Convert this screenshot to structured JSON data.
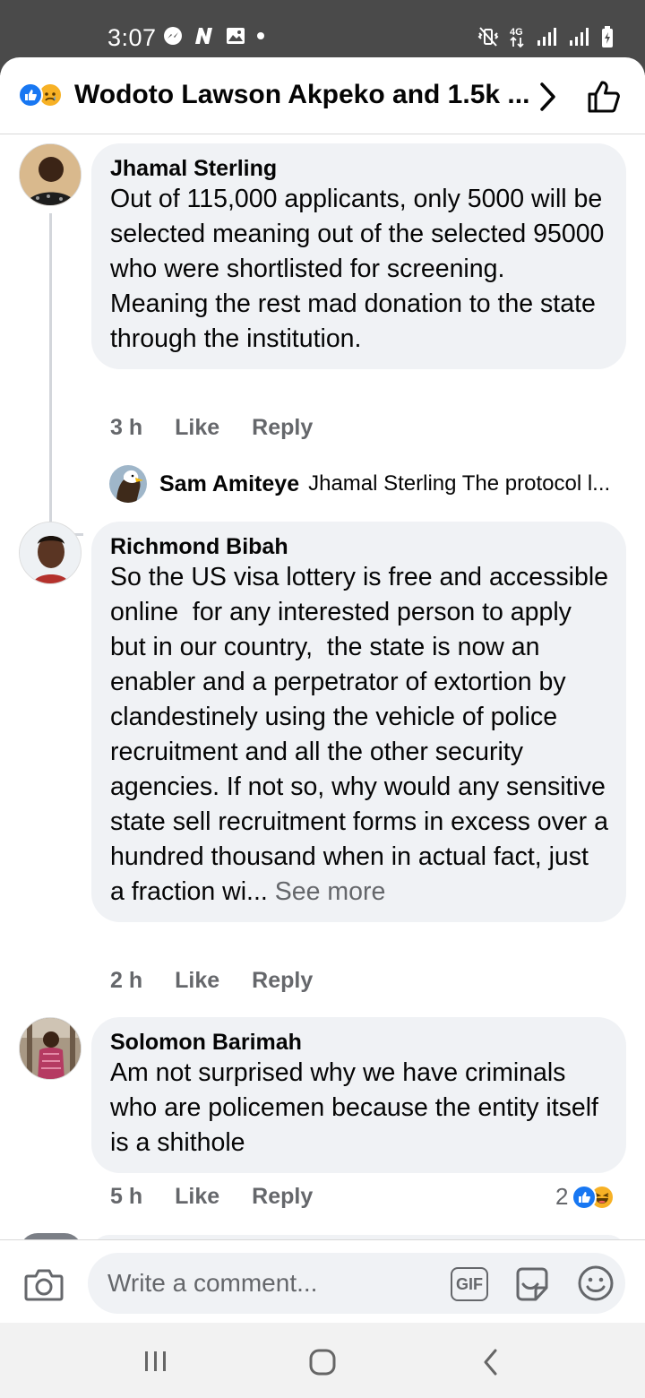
{
  "status_bar": {
    "time": "3:07",
    "left_icons": [
      "messenger-icon",
      "n-app-icon",
      "gallery-icon",
      "dot-icon"
    ],
    "right_icons": [
      "mute-vibrate-icon",
      "4g-icon",
      "signal-icon",
      "signal-icon",
      "battery-icon"
    ],
    "network": "4G"
  },
  "header": {
    "title": "Wodoto Lawson Akpeko and 1.5k ...",
    "reactions": [
      "like",
      "sad"
    ],
    "colors": {
      "like": "#1877f2",
      "sad": "#f7b125"
    }
  },
  "comments": [
    {
      "author": "Jhamal Sterling",
      "text": "Out of 115,000 applicants, only 5000 will be selected meaning out of the selected 95000 who were shortlisted for screening. Meaning the rest mad donation to the state through the institution.",
      "time": "3 h",
      "like_label": "Like",
      "reply_label": "Reply",
      "reply": {
        "author": "Sam Amiteye",
        "text": "Jhamal Sterling The protocol l..."
      }
    },
    {
      "author": "Richmond Bibah",
      "text": "So the US visa lottery is free and accessible online  for any interested person to apply but in our country,  the state is now an enabler and a perpetrator of extortion by clandestinely using the vehicle of police recruitment and all the other security agencies. If not so, why would any sensitive state sell recruitment forms in excess over a hundred thousand when in actual fact, just a fraction wi... ",
      "see_more": "See more",
      "time": "2 h",
      "like_label": "Like",
      "reply_label": "Reply"
    },
    {
      "author": "Solomon Barimah",
      "text": "Am not surprised why we have criminals who are policemen because the entity itself is a shithole",
      "time": "5 h",
      "like_label": "Like",
      "reply_label": "Reply",
      "reaction_count": "2",
      "reactions": [
        "like",
        "haha"
      ]
    }
  ],
  "composer": {
    "placeholder": "Write a comment...",
    "gif_label": "GIF"
  },
  "navbar": {
    "buttons": [
      "recent-apps",
      "home",
      "back"
    ]
  }
}
